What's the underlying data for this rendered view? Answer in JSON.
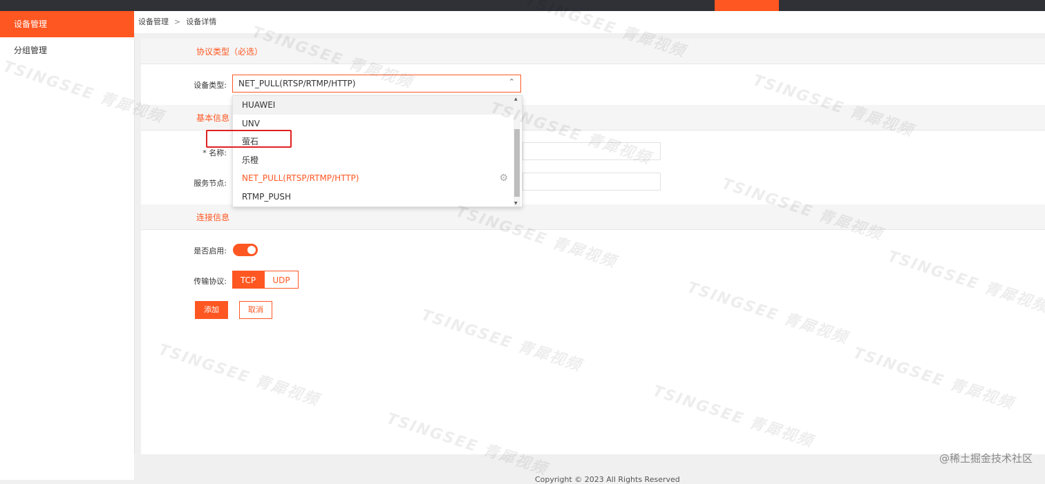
{
  "sidebar": {
    "items": [
      {
        "label": "设备管理"
      },
      {
        "label": "分组管理"
      }
    ]
  },
  "breadcrumb": {
    "parent": "设备管理",
    "separator": ">",
    "current": "设备详情"
  },
  "sections": {
    "protocol": "协议类型（必选）",
    "basic": "基本信息",
    "connection": "连接信息"
  },
  "form": {
    "device_type_label": "设备类型:",
    "device_type_value": "NET_PULL(RTSP/RTMP/HTTP)",
    "name_label": "* 名称:",
    "service_node_label": "服务节点:",
    "enabled_label": "是否启用:",
    "enabled": true,
    "transport_label": "传输协议:",
    "transport_options": [
      "TCP",
      "UDP"
    ],
    "transport_selected": "TCP"
  },
  "dropdown": {
    "options": [
      "HUAWEI",
      "UNV",
      "萤石",
      "乐橙",
      "NET_PULL(RTSP/RTMP/HTTP)",
      "RTMP_PUSH"
    ],
    "selected": "NET_PULL(RTSP/RTMP/HTTP)",
    "highlighted": "萤石"
  },
  "buttons": {
    "add": "添加",
    "cancel": "取消"
  },
  "footer": {
    "text": "Copyright © 2023 All Rights Reserved"
  },
  "watermark": {
    "text": "TSINGSEE 青犀视频"
  },
  "credit": "@稀土掘金技术社区",
  "colors": {
    "accent": "#ff5722",
    "topbar": "#2f3136",
    "highlight_box": "#e02020"
  }
}
